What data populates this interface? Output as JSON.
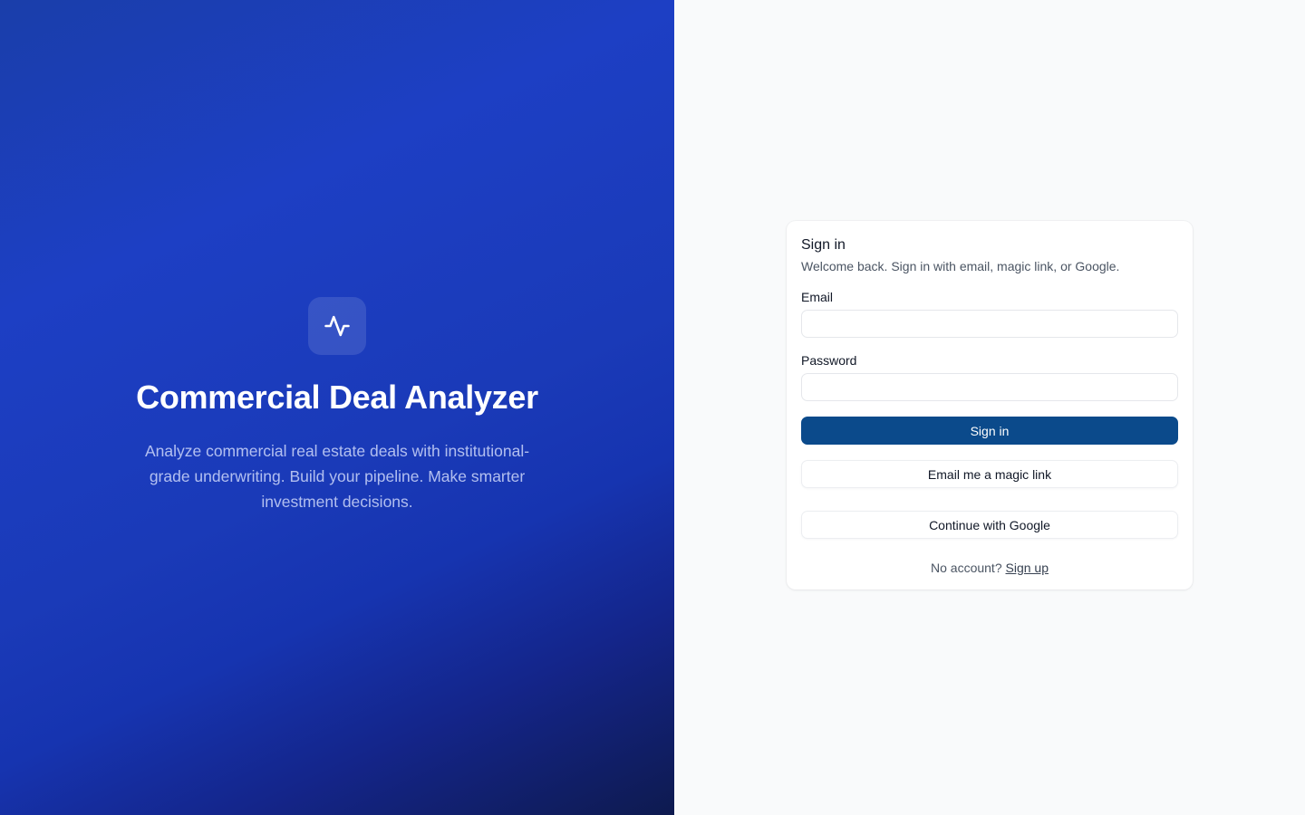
{
  "hero": {
    "logo_icon": "activity-pulse-icon",
    "title": "Commercial Deal Analyzer",
    "description": "Analyze commercial real estate deals with institutional-grade underwriting. Build your pipeline. Make smarter investment decisions."
  },
  "signin": {
    "title": "Sign in",
    "subtitle": "Welcome back. Sign in with email, magic link, or Google.",
    "email_label": "Email",
    "email_value": "",
    "password_label": "Password",
    "password_value": "",
    "submit_label": "Sign in",
    "magic_link_label": "Email me a magic link",
    "google_label": "Continue with Google",
    "no_account_text": "No account?",
    "signup_label": "Sign up"
  },
  "colors": {
    "primary": "#0b4a8b",
    "hero_gradient_start": "#1a3eaa",
    "hero_gradient_end": "#0e1a4f",
    "panel_bg": "#f9fafb"
  }
}
